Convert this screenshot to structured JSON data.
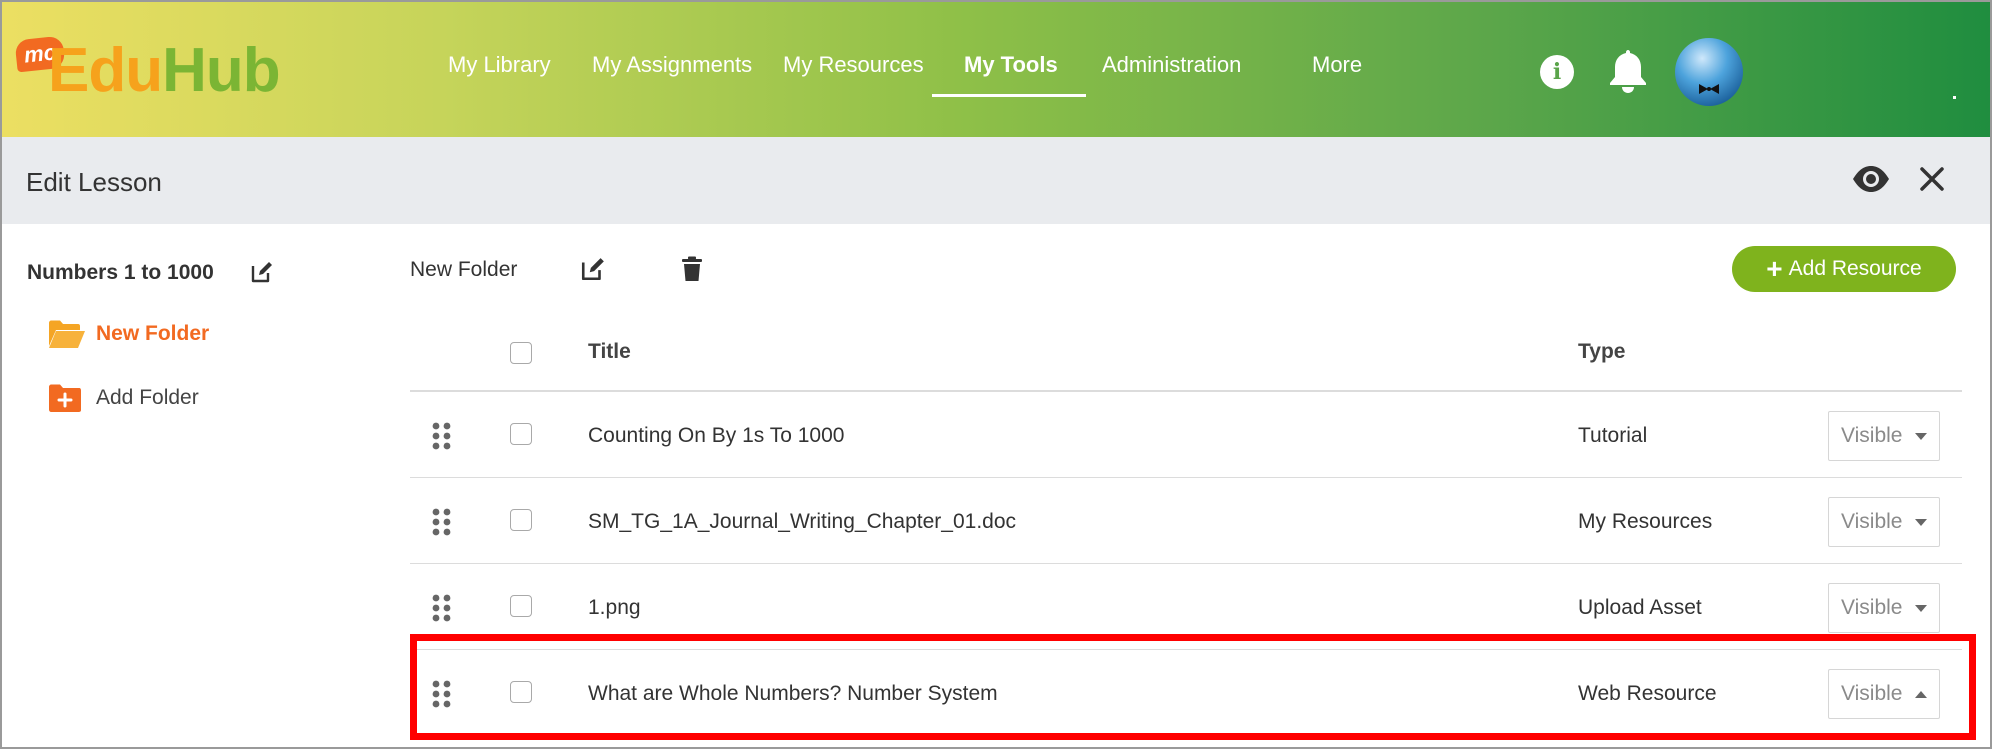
{
  "app": {
    "logo_badge": "mc",
    "logo_part1": "Edu",
    "logo_part2": "Hub"
  },
  "nav": {
    "items": [
      {
        "label": "My Library",
        "active": false
      },
      {
        "label": "My Assignments",
        "active": false
      },
      {
        "label": "My Resources",
        "active": false
      },
      {
        "label": "My Tools",
        "active": true
      },
      {
        "label": "Administration",
        "active": false
      },
      {
        "label": "More",
        "active": false
      }
    ],
    "info_icon_glyph": "i"
  },
  "header": {
    "title": "Edit Lesson"
  },
  "sidebar": {
    "lesson_name": "Numbers 1 to 1000",
    "folders": [
      {
        "label": "New Folder",
        "active": true,
        "icon": "folder-open-icon"
      },
      {
        "label": "Add Folder",
        "active": false,
        "icon": "folder-add-icon"
      }
    ]
  },
  "toolbar": {
    "folder_name": "New Folder",
    "add_resource_label": "Add Resource",
    "add_resource_plus": "+"
  },
  "table": {
    "columns": {
      "title": "Title",
      "type": "Type"
    },
    "rows": [
      {
        "title": "Counting On By 1s To 1000",
        "type": "Tutorial",
        "visibility": "Visible",
        "dropdown_open": false
      },
      {
        "title": "SM_TG_1A_Journal_Writing_Chapter_01.doc",
        "type": "My Resources",
        "visibility": "Visible",
        "dropdown_open": false
      },
      {
        "title": "1.png",
        "type": "Upload Asset",
        "visibility": "Visible",
        "dropdown_open": false
      },
      {
        "title": "What are Whole Numbers? Number System",
        "type": "Web Resource",
        "visibility": "Visible",
        "dropdown_open": true
      }
    ]
  },
  "colors": {
    "accent_orange": "#f26a21",
    "add_button_green": "#7fb31d",
    "highlight_red": "#ff0000",
    "header_bg": "#e9ebee"
  }
}
